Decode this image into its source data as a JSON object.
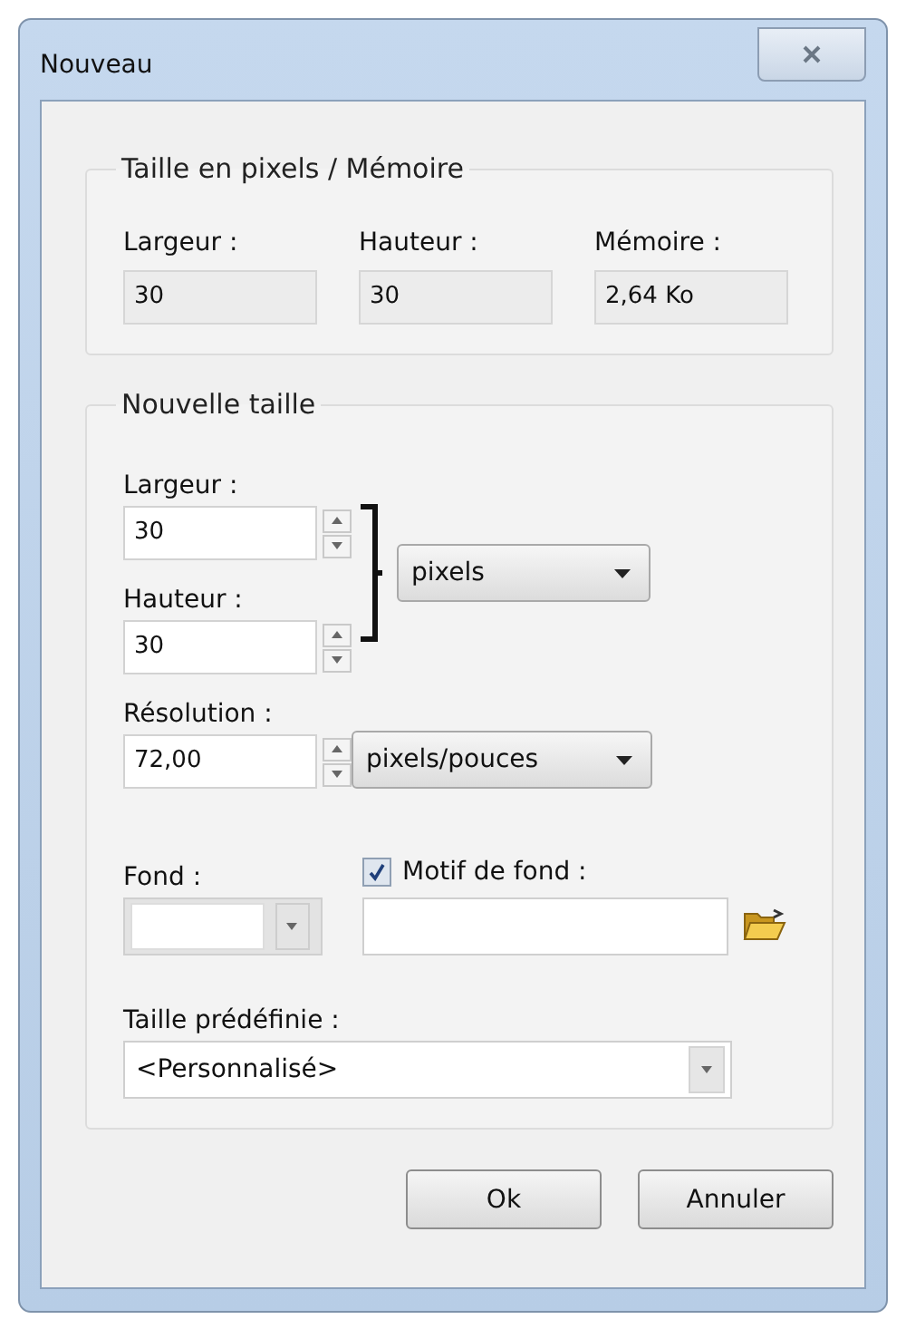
{
  "window": {
    "title": "Nouveau"
  },
  "pixel_size_group": {
    "title": "Taille en pixels / Mémoire",
    "fields": [
      {
        "label": "Largeur :",
        "value": "30"
      },
      {
        "label": "Hauteur :",
        "value": "30"
      },
      {
        "label": "Mémoire :",
        "value": "2,64 Ko"
      }
    ]
  },
  "new_size_group": {
    "title": "Nouvelle taille",
    "width": {
      "label": "Largeur :",
      "value": "30"
    },
    "height": {
      "label": "Hauteur :",
      "value": "30"
    },
    "unit": {
      "value": "pixels"
    },
    "resolution": {
      "label": "Résolution :",
      "value": "72,00"
    },
    "resolution_unit": {
      "value": "pixels/pouces"
    },
    "background": {
      "label": "Fond :",
      "disabled": true
    },
    "pattern": {
      "label": "Motif de fond :",
      "checked": true
    },
    "preset": {
      "label": "Taille prédéfinie :",
      "value": "<Personnalisé>"
    }
  },
  "buttons": [
    "Ok",
    "Annuler"
  ]
}
